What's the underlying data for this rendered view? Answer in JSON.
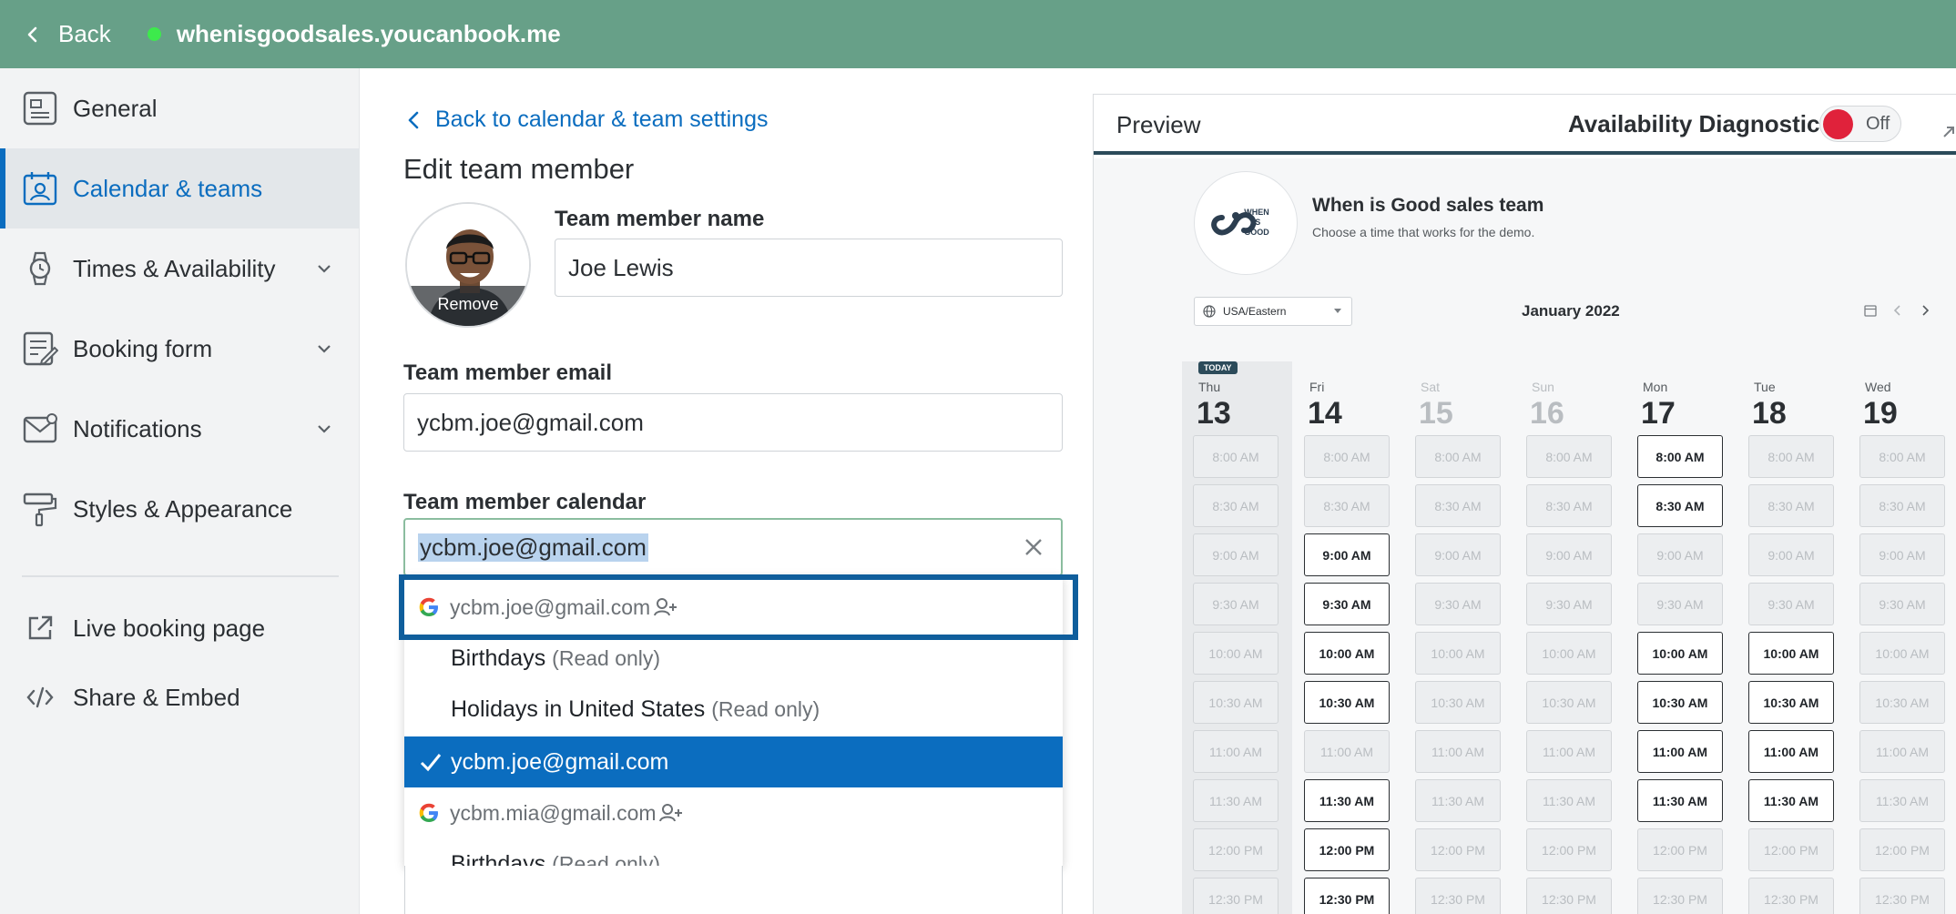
{
  "topbar": {
    "back_label": "Back",
    "domain": "whenisgoodsales.youcanbook.me",
    "status_color": "#3dea4c",
    "bar_color": "#67a088"
  },
  "sidebar": {
    "items": [
      {
        "label": "General",
        "icon": "general-icon"
      },
      {
        "label": "Calendar & teams",
        "icon": "calendar-team-icon",
        "active": true
      },
      {
        "label": "Times & Availability",
        "icon": "watch-icon",
        "expandable": true
      },
      {
        "label": "Booking form",
        "icon": "form-icon",
        "expandable": true
      },
      {
        "label": "Notifications",
        "icon": "mail-icon",
        "expandable": true
      },
      {
        "label": "Styles & Appearance",
        "icon": "paint-roller-icon"
      }
    ],
    "links": [
      {
        "label": "Live booking page",
        "icon": "external-link-icon"
      },
      {
        "label": "Share & Embed",
        "icon": "code-icon"
      }
    ],
    "accent": "#0b6dbf"
  },
  "form": {
    "back_link": "Back to calendar & team settings",
    "title": "Edit team member",
    "avatar_remove": "Remove",
    "name_label": "Team member name",
    "name_value": "Joe Lewis",
    "email_label": "Team member email",
    "email_value": "ycbm.joe@gmail.com",
    "calendar_label": "Team member calendar",
    "calendar_value": "ycbm.joe@gmail.com"
  },
  "dropdown": {
    "items": [
      {
        "type": "account",
        "label": "ycbm.joe@gmail.com"
      },
      {
        "type": "calendar",
        "label": "Birthdays",
        "suffix": "(Read only)"
      },
      {
        "type": "calendar",
        "label": "Holidays in United States",
        "suffix": "(Read only)"
      },
      {
        "type": "calendar",
        "label": "ycbm.joe@gmail.com",
        "selected": true
      },
      {
        "type": "account",
        "label": "ycbm.mia@gmail.com"
      },
      {
        "type": "calendar",
        "label": "Birthdays",
        "suffix": "(Read only)"
      }
    ]
  },
  "preview": {
    "title": "Preview",
    "diagnostics_label": "Availability Diagnostics",
    "diagnostics_state": "Off",
    "team_name": "When is Good sales team",
    "team_sub": "Choose a time that works for the demo.",
    "logo_text": [
      "WHEN",
      "IS",
      "GOOD"
    ],
    "timezone": "USA/Eastern",
    "month": "January 2022",
    "today_badge": "TODAY",
    "days": [
      {
        "dow": "Thu",
        "num": "13",
        "today": true,
        "disabled": false
      },
      {
        "dow": "Fri",
        "num": "14",
        "disabled": false
      },
      {
        "dow": "Sat",
        "num": "15",
        "disabled": true
      },
      {
        "dow": "Sun",
        "num": "16",
        "disabled": true
      },
      {
        "dow": "Mon",
        "num": "17",
        "disabled": false
      },
      {
        "dow": "Tue",
        "num": "18",
        "disabled": false
      },
      {
        "dow": "Wed",
        "num": "19",
        "disabled": false
      }
    ],
    "times": [
      "8:00 AM",
      "8:30 AM",
      "9:00 AM",
      "9:30 AM",
      "10:00 AM",
      "10:30 AM",
      "11:00 AM",
      "11:30 AM",
      "12:00 PM",
      "12:30 PM"
    ],
    "availability": [
      [
        false,
        false,
        false,
        false,
        false,
        false,
        false,
        false,
        false,
        false
      ],
      [
        false,
        false,
        true,
        true,
        true,
        true,
        false,
        true,
        true,
        true
      ],
      [
        false,
        false,
        false,
        false,
        false,
        false,
        false,
        false,
        false,
        false
      ],
      [
        false,
        false,
        false,
        false,
        false,
        false,
        false,
        false,
        false,
        false
      ],
      [
        true,
        true,
        false,
        false,
        true,
        true,
        true,
        true,
        false,
        false
      ],
      [
        false,
        false,
        false,
        false,
        true,
        true,
        true,
        true,
        false,
        false
      ],
      [
        false,
        false,
        false,
        false,
        false,
        false,
        false,
        false,
        false,
        false
      ]
    ]
  }
}
